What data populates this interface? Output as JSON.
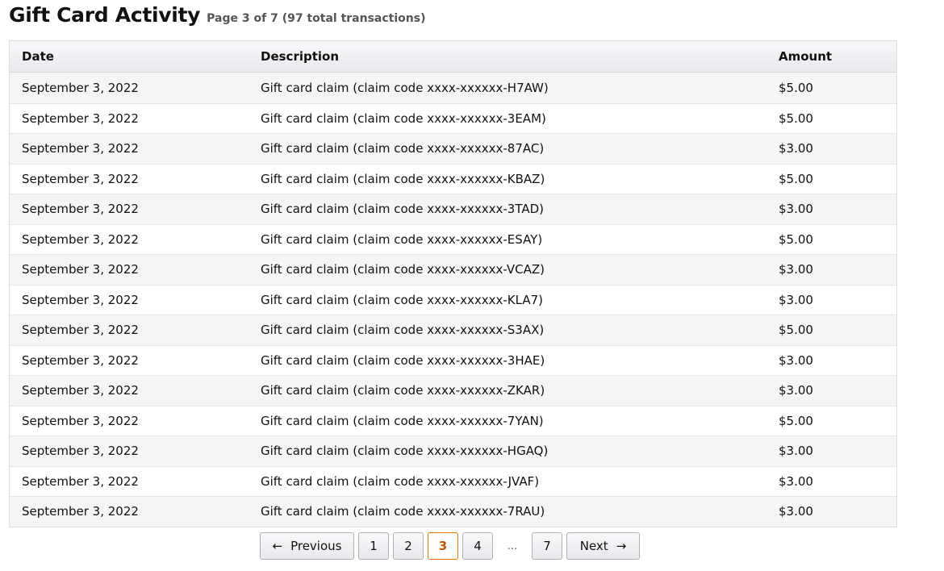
{
  "header": {
    "title": "Gift Card Activity",
    "subtitle": "Page 3 of 7 (97 total transactions)"
  },
  "table": {
    "columns": [
      "Date",
      "Description",
      "Amount"
    ],
    "rows": [
      {
        "date": "September 3, 2022",
        "description": "Gift card claim (claim code xxxx-xxxxxx-H7AW)",
        "amount": "$5.00"
      },
      {
        "date": "September 3, 2022",
        "description": "Gift card claim (claim code xxxx-xxxxxx-3EAM)",
        "amount": "$5.00"
      },
      {
        "date": "September 3, 2022",
        "description": "Gift card claim (claim code xxxx-xxxxxx-87AC)",
        "amount": "$3.00"
      },
      {
        "date": "September 3, 2022",
        "description": "Gift card claim (claim code xxxx-xxxxxx-KBAZ)",
        "amount": "$5.00"
      },
      {
        "date": "September 3, 2022",
        "description": "Gift card claim (claim code xxxx-xxxxxx-3TAD)",
        "amount": "$3.00"
      },
      {
        "date": "September 3, 2022",
        "description": "Gift card claim (claim code xxxx-xxxxxx-ESAY)",
        "amount": "$5.00"
      },
      {
        "date": "September 3, 2022",
        "description": "Gift card claim (claim code xxxx-xxxxxx-VCAZ)",
        "amount": "$3.00"
      },
      {
        "date": "September 3, 2022",
        "description": "Gift card claim (claim code xxxx-xxxxxx-KLA7)",
        "amount": "$3.00"
      },
      {
        "date": "September 3, 2022",
        "description": "Gift card claim (claim code xxxx-xxxxxx-S3AX)",
        "amount": "$5.00"
      },
      {
        "date": "September 3, 2022",
        "description": "Gift card claim (claim code xxxx-xxxxxx-3HAE)",
        "amount": "$3.00"
      },
      {
        "date": "September 3, 2022",
        "description": "Gift card claim (claim code xxxx-xxxxxx-ZKAR)",
        "amount": "$3.00"
      },
      {
        "date": "September 3, 2022",
        "description": "Gift card claim (claim code xxxx-xxxxxx-7YAN)",
        "amount": "$5.00"
      },
      {
        "date": "September 3, 2022",
        "description": "Gift card claim (claim code xxxx-xxxxxx-HGAQ)",
        "amount": "$3.00"
      },
      {
        "date": "September 3, 2022",
        "description": "Gift card claim (claim code xxxx-xxxxxx-JVAF)",
        "amount": "$3.00"
      },
      {
        "date": "September 3, 2022",
        "description": "Gift card claim (claim code xxxx-xxxxxx-7RAU)",
        "amount": "$3.00"
      }
    ]
  },
  "pagination": {
    "prev_label": "Previous",
    "prev_arrow": "←",
    "next_label": "Next",
    "next_arrow": "→",
    "pages": [
      "1",
      "2",
      "3",
      "4"
    ],
    "current": "3",
    "ellipsis": "...",
    "last_page": "7"
  },
  "colors": {
    "current_page_border": "#e77600",
    "current_page_text": "#c45500"
  }
}
